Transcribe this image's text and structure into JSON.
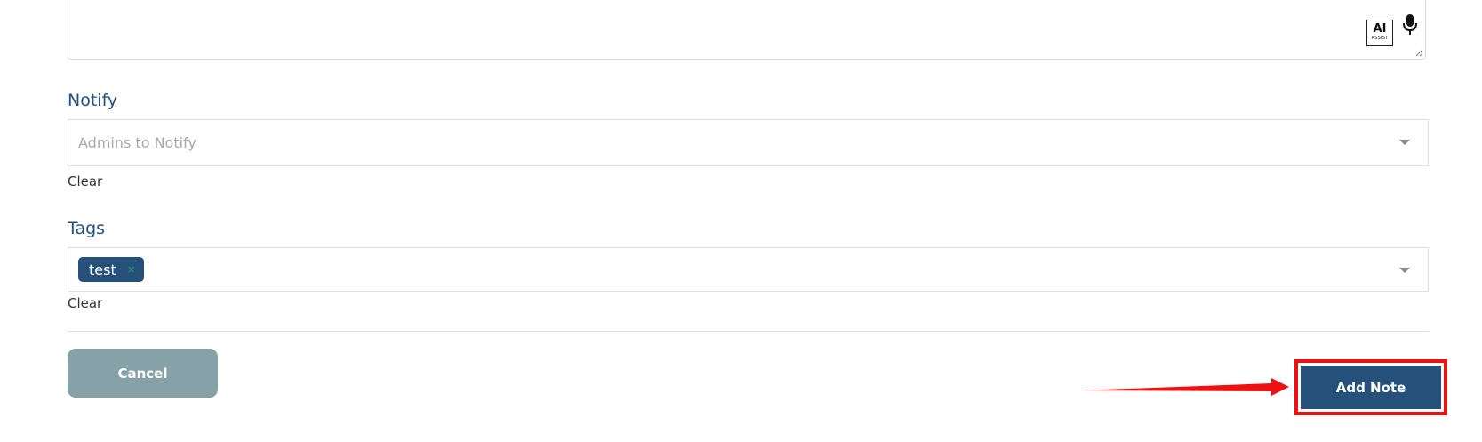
{
  "note_area": {
    "ai_assist_label": "AI",
    "ai_assist_sublabel": "ASSIST"
  },
  "notify": {
    "label": "Notify",
    "placeholder": "Admins to Notify",
    "clear_label": "Clear"
  },
  "tags": {
    "label": "Tags",
    "items": [
      {
        "label": "test",
        "remove_glyph": "×"
      }
    ],
    "clear_label": "Clear"
  },
  "actions": {
    "cancel_label": "Cancel",
    "add_note_label": "Add Note"
  },
  "colors": {
    "primary": "#24507a",
    "cancel_bg": "#87a1a9",
    "annotation_red": "#ee1111",
    "label_blue": "#24507a"
  },
  "icons": {
    "mic": "microphone-icon",
    "caret": "caret-down-icon",
    "ai_assist": "ai-assist-icon"
  }
}
